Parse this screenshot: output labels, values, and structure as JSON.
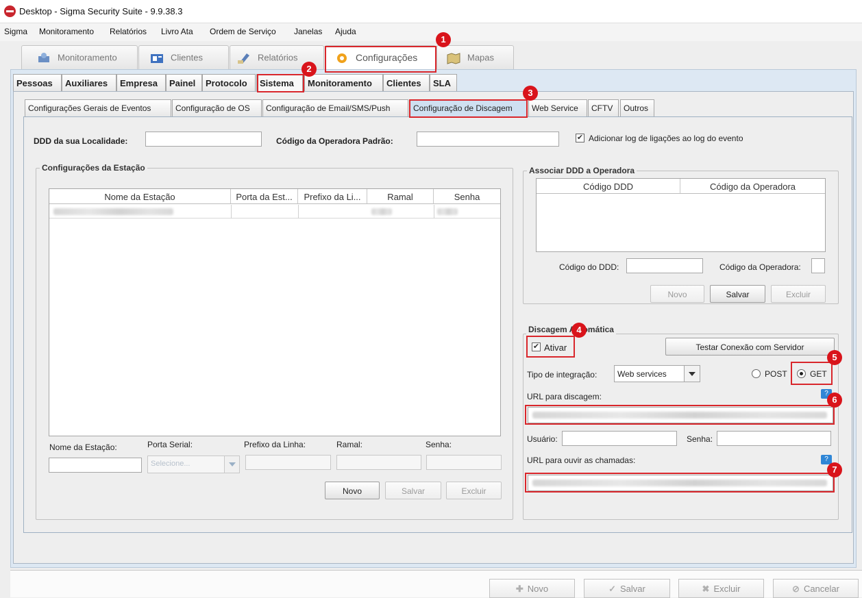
{
  "window": {
    "title": "Desktop - Sigma Security Suite - 9.9.38.3"
  },
  "menu": [
    "Sigma",
    "Monitoramento",
    "Relatórios",
    "Livro Ata",
    "Ordem de Serviço",
    "Janelas",
    "Ajuda"
  ],
  "main_tabs": [
    {
      "label": "Monitoramento",
      "icon": "monitoring-icon"
    },
    {
      "label": "Clientes",
      "icon": "clients-icon"
    },
    {
      "label": "Relatórios",
      "icon": "reports-icon"
    },
    {
      "label": "Configurações",
      "icon": "settings-gear-icon"
    },
    {
      "label": "Mapas",
      "icon": "maps-icon"
    }
  ],
  "sub_tabs": [
    "Pessoas",
    "Auxiliares",
    "Empresa",
    "Painel",
    "Protocolo",
    "Sistema",
    "Monitoramento",
    "Clientes",
    "SLA"
  ],
  "inner_tabs": [
    "Configurações Gerais de Eventos",
    "Configuração de OS",
    "Configuração de  Email/SMS/Push",
    "Configuração de Discagem",
    "Web Service",
    "CFTV",
    "Outros"
  ],
  "top_fields": {
    "ddd_label": "DDD da sua Localidade:",
    "ddd_value": "",
    "operadora_label": "Código da Operadora Padrão:",
    "operadora_value": "",
    "log_checkbox_label": "Adicionar log de ligações ao log do evento",
    "log_checked": true
  },
  "estacao": {
    "group_title": "Configurações da Estação",
    "columns": [
      "Nome da Estação",
      "Porta da Est...",
      "Prefixo da Li...",
      "Ramal",
      "Senha"
    ],
    "form": {
      "nome_label": "Nome da Estação:",
      "porta_label": "Porta Serial:",
      "porta_placeholder": "Selecione...",
      "prefixo_label": "Prefixo da Linha:",
      "ramal_label": "Ramal:",
      "senha_label": "Senha:"
    },
    "buttons": {
      "novo": "Novo",
      "salvar": "Salvar",
      "excluir": "Excluir"
    }
  },
  "ddd_operadora": {
    "group_title": "Associar DDD a Operadora",
    "columns": [
      "Código DDD",
      "Código da Operadora"
    ],
    "ddd_label": "Código do DDD:",
    "operadora_label": "Código da Operadora:",
    "buttons": {
      "novo": "Novo",
      "salvar": "Salvar",
      "excluir": "Excluir"
    }
  },
  "discagem": {
    "group_title": "Discagem Automática",
    "ativar_label": "Ativar",
    "ativar_checked": true,
    "testar_button": "Testar Conexão com Servidor",
    "tipo_label": "Tipo de integração:",
    "tipo_value": "Web services",
    "post_label": "POST",
    "get_label": "GET",
    "method_selected": "GET",
    "url_discagem_label": "URL para discagem:",
    "usuario_label": "Usuário:",
    "senha_label": "Senha:",
    "url_ouvir_label": "URL para ouvir as chamadas:"
  },
  "markers": [
    "1",
    "2",
    "3",
    "4",
    "5",
    "6",
    "7"
  ],
  "bottom_buttons": [
    {
      "label": "Novo",
      "icon": "plus-icon"
    },
    {
      "label": "Salvar",
      "icon": "checkmark-icon"
    },
    {
      "label": "Excluir",
      "icon": "x-icon"
    },
    {
      "label": "Cancelar",
      "icon": "cancel-icon"
    }
  ],
  "colors": {
    "highlight": "#d9262b",
    "panel_blue": "#dde8f3",
    "selected_tab": "#cfe0f1"
  }
}
